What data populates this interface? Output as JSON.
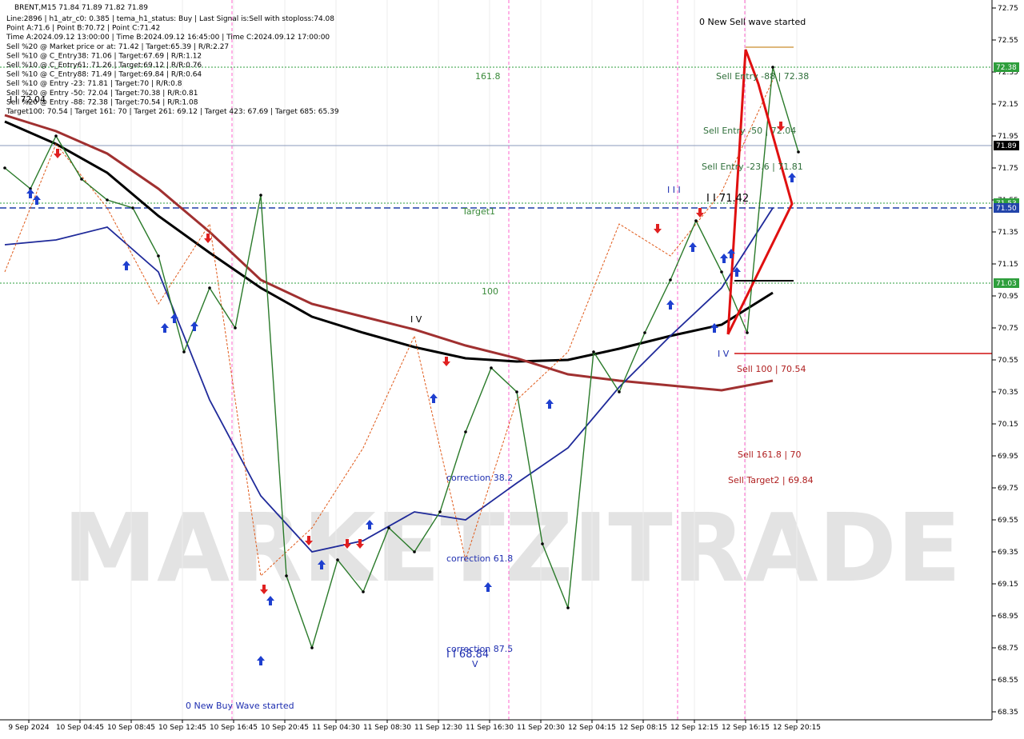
{
  "chart_data": {
    "type": "line",
    "title": "BRENT,M15  71.84 71.89 71.82 71.89",
    "info_lines": [
      "Line:2896  |  h1_atr_c0: 0.385  |  tema_h1_status: Buy  |  Last Signal is:Sell with stoploss:74.08",
      "Point A:71.6  |  Point B:70.72  |  Point C:71.42",
      "Time A:2024.09.12 13:00:00  |  Time B:2024.09.12 16:45:00  |  Time C:2024.09.12 17:00:00",
      "Sell %20 @ Market price or at: 71.42  |  Target:65.39  |  R/R:2.27",
      "Sell %10 @ C_Entry38: 71.06  |  Target:67.69  |  R/R:1.12",
      "Sell %10 @ C_Entry61: 71.26  |  Target:69.12  |  R/R:0.76",
      "Sell %10 @ C_Entry88: 71.49  |  Target:69.84  |  R/R:0.64",
      "Sell %10 @ Entry -23: 71.81  |  Target:70  |  R/R:0.8",
      "Sell %20 @ Entry -50: 72.04  |  Target:70.38  |  R/R:0.81",
      "Sell %20 @ Entry -88: 72.38  |  Target:70.54  |  R/R:1.08",
      "Target100: 70.54  |  Target 161: 70  |  Target 261: 69.12  |  Target 423: 67.69  |  Target 685: 65.39"
    ],
    "y_ticks": [
      "72.75",
      "72.55",
      "72.35",
      "72.15",
      "71.95",
      "71.75",
      "71.55",
      "71.35",
      "71.15",
      "70.95",
      "70.75",
      "70.55",
      "70.35",
      "70.15",
      "69.95",
      "69.75",
      "69.55",
      "69.35",
      "69.15",
      "68.95",
      "68.75",
      "68.55",
      "68.35"
    ],
    "ylim": [
      68.3,
      72.8
    ],
    "x_ticks": [
      "9 Sep 2024",
      "10 Sep 04:45",
      "10 Sep 08:45",
      "10 Sep 12:45",
      "10 Sep 16:45",
      "10 Sep 20:45",
      "11 Sep 04:30",
      "11 Sep 08:30",
      "11 Sep 12:30",
      "11 Sep 16:30",
      "11 Sep 20:30",
      "12 Sep 04:15",
      "12 Sep 08:15",
      "12 Sep 12:15",
      "12 Sep 16:15",
      "12 Sep 20:15"
    ],
    "price_tags": [
      {
        "label": "72.38",
        "value": 72.38,
        "color": "#2e9e3c"
      },
      {
        "label": "71.89",
        "value": 71.89,
        "color": "#000000"
      },
      {
        "label": "71.53",
        "value": 71.53,
        "color": "#2e9e3c"
      },
      {
        "label": "71.50",
        "value": 71.5,
        "color": "#2244aa"
      },
      {
        "label": "71.03",
        "value": 71.03,
        "color": "#2e9e3c"
      }
    ],
    "levels": [
      {
        "value": 72.38,
        "style": "dotted",
        "color": "#2e9e3c"
      },
      {
        "value": 71.89,
        "style": "solid",
        "color": "#8899bb"
      },
      {
        "value": 71.53,
        "style": "dotted",
        "color": "#2e9e3c"
      },
      {
        "value": 71.5,
        "style": "dashed",
        "color": "#1f3da8"
      },
      {
        "value": 71.03,
        "style": "dotted",
        "color": "#2e9e3c"
      }
    ],
    "annotations": [
      {
        "text": "0 New Sell wave started",
        "color": "#000000"
      },
      {
        "text": "161.8",
        "color": "#3a8a3a"
      },
      {
        "text": "Sell Entry -88 | 72.38",
        "color": "#2f6f3a"
      },
      {
        "text": "Sell Entry -50 | 72.04",
        "color": "#2f6f3a"
      },
      {
        "text": "Sell Entry -23.6 | 71.81",
        "color": "#2f6f3a"
      },
      {
        "text": "I I 71.42",
        "color": "#000000"
      },
      {
        "text": "Target1",
        "color": "#3a8a3a"
      },
      {
        "text": "100",
        "color": "#3a8a3a"
      },
      {
        "text": "Sell 100 | 70.54",
        "color": "#b02020"
      },
      {
        "text": "Sell 161.8 | 70",
        "color": "#b02020"
      },
      {
        "text": "Sell Target2 | 69.84",
        "color": "#b02020"
      },
      {
        "text": "correction 38.2",
        "color": "#1f2fb0"
      },
      {
        "text": "correction 61.8",
        "color": "#1f2fb0"
      },
      {
        "text": "correction 87.5",
        "color": "#1f2fb0"
      },
      {
        "text": "I I 68.84",
        "color": "#1f2fb0"
      },
      {
        "text": "0 New Buy Wave started",
        "color": "#1f2fb0"
      },
      {
        "text": "I I 72.04",
        "color": "#000000"
      },
      {
        "text": "I V",
        "color": "#000000"
      },
      {
        "text": "V",
        "color": "#1f2fb0"
      },
      {
        "text": "I I I",
        "color": "#1f2fb0"
      },
      {
        "text": "I V",
        "color": "#1f2fb0"
      }
    ],
    "series": [
      {
        "color": "#000000",
        "x": [
          0,
          10,
          20,
          30,
          40,
          50,
          60,
          70,
          80,
          90,
          100,
          110,
          120,
          130,
          140,
          150
        ],
        "values": [
          72.04,
          71.9,
          71.72,
          71.45,
          71.22,
          71.0,
          70.82,
          70.72,
          70.63,
          70.56,
          70.54,
          70.55,
          70.62,
          70.7,
          70.77,
          70.97
        ]
      },
      {
        "color": "#a03030",
        "x": [
          0,
          10,
          20,
          30,
          40,
          50,
          60,
          70,
          80,
          90,
          100,
          110,
          120,
          130,
          140,
          150
        ],
        "values": [
          72.08,
          71.98,
          71.84,
          71.62,
          71.35,
          71.05,
          70.9,
          70.82,
          70.74,
          70.64,
          70.56,
          70.46,
          70.42,
          70.39,
          70.36,
          70.42
        ]
      },
      {
        "color": "#1f2a9a",
        "x": [
          0,
          10,
          20,
          30,
          40,
          50,
          60,
          70,
          80,
          90,
          100,
          110,
          120,
          130,
          140,
          150
        ],
        "values": [
          71.27,
          71.3,
          71.38,
          71.1,
          70.3,
          69.7,
          69.35,
          69.42,
          69.6,
          69.55,
          69.78,
          70.0,
          70.38,
          70.7,
          71.0,
          71.5
        ]
      },
      {
        "color": "#e05a1a",
        "x": [
          0,
          10,
          20,
          30,
          40,
          50,
          60,
          70,
          80,
          90,
          100,
          110,
          120,
          130,
          140,
          150
        ],
        "values": [
          71.1,
          71.9,
          71.5,
          70.9,
          71.4,
          69.2,
          69.5,
          70.0,
          70.7,
          69.3,
          70.3,
          70.6,
          71.4,
          71.2,
          71.6,
          72.3
        ]
      }
    ],
    "close_prices": {
      "x": [
        0,
        5,
        10,
        15,
        20,
        25,
        30,
        35,
        40,
        45,
        50,
        55,
        60,
        65,
        70,
        75,
        80,
        85,
        90,
        95,
        100,
        105,
        110,
        115,
        120,
        125,
        130,
        135,
        140,
        145,
        150,
        155
      ],
      "values": [
        71.75,
        71.62,
        71.95,
        71.68,
        71.55,
        71.5,
        71.2,
        70.6,
        71.0,
        70.75,
        71.58,
        69.2,
        68.75,
        69.3,
        69.1,
        69.5,
        69.35,
        69.6,
        70.1,
        70.5,
        70.35,
        69.4,
        69.0,
        70.6,
        70.35,
        70.72,
        71.05,
        71.42,
        71.1,
        70.72,
        72.38,
        71.85
      ]
    }
  },
  "watermark": "MARKETZITRADE"
}
